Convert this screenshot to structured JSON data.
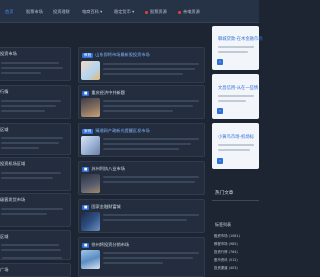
{
  "nav": {
    "items": [
      {
        "label": "首页",
        "active": true
      },
      {
        "label": "股票市场"
      },
      {
        "label": "投资理财"
      },
      {
        "label": "电商百科"
      },
      {
        "label": "稳定货币"
      },
      {
        "label": "股票资源",
        "dot": true
      },
      {
        "label": "亲电资源",
        "dot": true
      }
    ]
  },
  "left": {
    "titles": [
      "投资市场",
      "行情",
      "区域",
      "投资机场区域",
      "级客发货市场",
      "区域",
      "广场"
    ]
  },
  "middle": {
    "cards": [
      {
        "tag": "教程",
        "title": "山东即将市场最新股投资市场"
      },
      {
        "tag": "",
        "title": "重庆经济中共新题"
      },
      {
        "tag": "案例",
        "title": "臻湘网产政新光提醒区发市场"
      },
      {
        "tag": "",
        "title": "苏州利执八业市场"
      },
      {
        "tag": "",
        "title": "国家金融财富城"
      },
      {
        "tag": "",
        "title": "徐州将投资分销市场"
      }
    ]
  },
  "right": {
    "cards": [
      {
        "title": "聊城贷款-在木金融市场"
      },
      {
        "title": "文昌信用-从在一些情"
      },
      {
        "title": "小黄鸟市场-机场标"
      }
    ],
    "hot_title": "热门文章",
    "tags_title": "标签列表",
    "hot_rows": [
      "融资市场 (1081)",
      "教程市场 (985)",
      "投资行情 (764)",
      "股市资讯 (512)",
      "投资渠道 (403)"
    ]
  },
  "colors": {
    "accent": "#2f6fd6",
    "bg": "#1d2533",
    "red": "#e0433c"
  }
}
